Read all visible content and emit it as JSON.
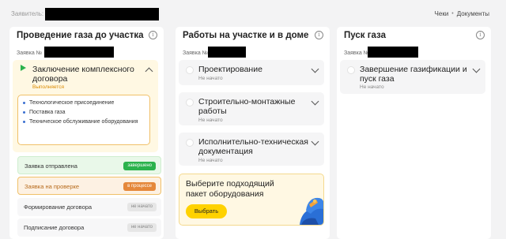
{
  "header": {
    "applicant_label": "Заявитель:",
    "checks_label": "Чеки",
    "separator": "•",
    "documents_label": "Документы"
  },
  "columns": {
    "gas_to_plot": {
      "title": "Проведение газа до участка",
      "request_label": "Заявка №",
      "stage": {
        "title": "Заключение комплексного договора",
        "status": "Выполняется",
        "subitems": [
          "Технологическое присоединение",
          "Поставка газа",
          "Техническое обслуживание оборудования"
        ]
      },
      "tasks": [
        {
          "label": "Заявка отправлена",
          "badge": "завершено"
        },
        {
          "label": "Заявка на проверке",
          "badge": "в процессе"
        },
        {
          "label": "Формирование договора",
          "badge": "не начато"
        },
        {
          "label": "Подписание договора",
          "badge": "не начато"
        }
      ]
    },
    "work_in_house": {
      "title": "Работы на участке и в доме",
      "request_label": "Заявка №",
      "stages": [
        {
          "title": "Проектирование",
          "status": "Не начато"
        },
        {
          "title": "Строительно-монтажные работы",
          "status": "Не начато"
        },
        {
          "title": "Исполнительно-техническая документация",
          "status": "Не начато"
        }
      ],
      "promo": {
        "title": "Выберите подходящий пакет оборудования",
        "button": "Выбрать"
      }
    },
    "gas_start": {
      "title": "Пуск газа",
      "request_label": "Заявка №",
      "stage": {
        "title": "Завершение газификации и пуск газа",
        "status": "Не начато"
      }
    }
  },
  "colors": {
    "accent_green": "#2bb24c",
    "accent_orange": "#e5883b",
    "accent_yellow": "#ffd200",
    "active_bg": "#fff8e3"
  }
}
